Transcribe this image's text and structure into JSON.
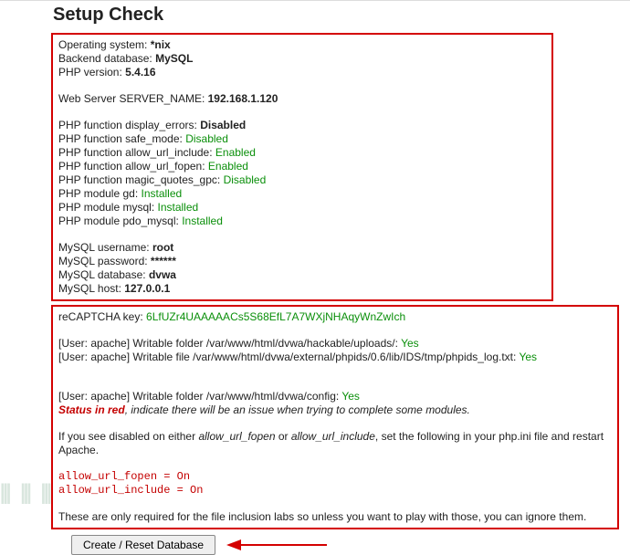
{
  "title": "Setup Check",
  "box1": {
    "os_label": "Operating system: ",
    "os_value": "*nix",
    "db_label": "Backend database: ",
    "db_value": "MySQL",
    "php_label": "PHP version: ",
    "php_value": "5.4.16",
    "ws_label": "Web Server SERVER_NAME: ",
    "ws_value": "192.168.1.120",
    "f_de_label": "PHP function display_errors: ",
    "f_de_value": "Disabled",
    "f_sm_label": "PHP function safe_mode: ",
    "f_sm_value": "Disabled",
    "f_aui_label": "PHP function allow_url_include: ",
    "f_aui_value": "Enabled",
    "f_auf_label": "PHP function allow_url_fopen: ",
    "f_auf_value": "Enabled",
    "f_mq_label": "PHP function magic_quotes_gpc: ",
    "f_mq_value": "Disabled",
    "m_gd_label": "PHP module gd: ",
    "m_gd_value": "Installed",
    "m_my_label": "PHP module mysql: ",
    "m_my_value": "Installed",
    "m_pdo_label": "PHP module pdo_mysql: ",
    "m_pdo_value": "Installed",
    "mu_label": "MySQL username: ",
    "mu_value": "root",
    "mp_label": "MySQL password: ",
    "mp_value": "******",
    "md_label": "MySQL database: ",
    "md_value": "dvwa",
    "mh_label": "MySQL host: ",
    "mh_value": "127.0.0.1"
  },
  "box2": {
    "rc_label": "reCAPTCHA key: ",
    "rc_value": "6LfUZr4UAAAAACs5S68EfL7A7WXjNHAqyWnZwIch",
    "w1_label": "[User: apache] Writable folder /var/www/html/dvwa/hackable/uploads/: ",
    "w1_value": "Yes",
    "w2_label": "[User: apache] Writable file /var/www/html/dvwa/external/phpids/0.6/lib/IDS/tmp/phpids_log.txt: ",
    "w2_value": "Yes",
    "w3_label": "[User: apache] Writable folder /var/www/html/dvwa/config: ",
    "w3_value": "Yes",
    "status_red": "Status in red",
    "status_rest": ", indicate there will be an issue when trying to complete some modules.",
    "note_pre": "If you see disabled on either ",
    "note_emph1": "allow_url_fopen",
    "note_mid": " or ",
    "note_emph2": "allow_url_include",
    "note_post": ", set the following in your php.ini file and restart Apache.",
    "conf_line1": "allow_url_fopen = On",
    "conf_line2": "allow_url_include = On",
    "foot": "These are only required for the file inclusion labs so unless you want to play with those, you can ignore them."
  },
  "button_label": "Create / Reset Database"
}
